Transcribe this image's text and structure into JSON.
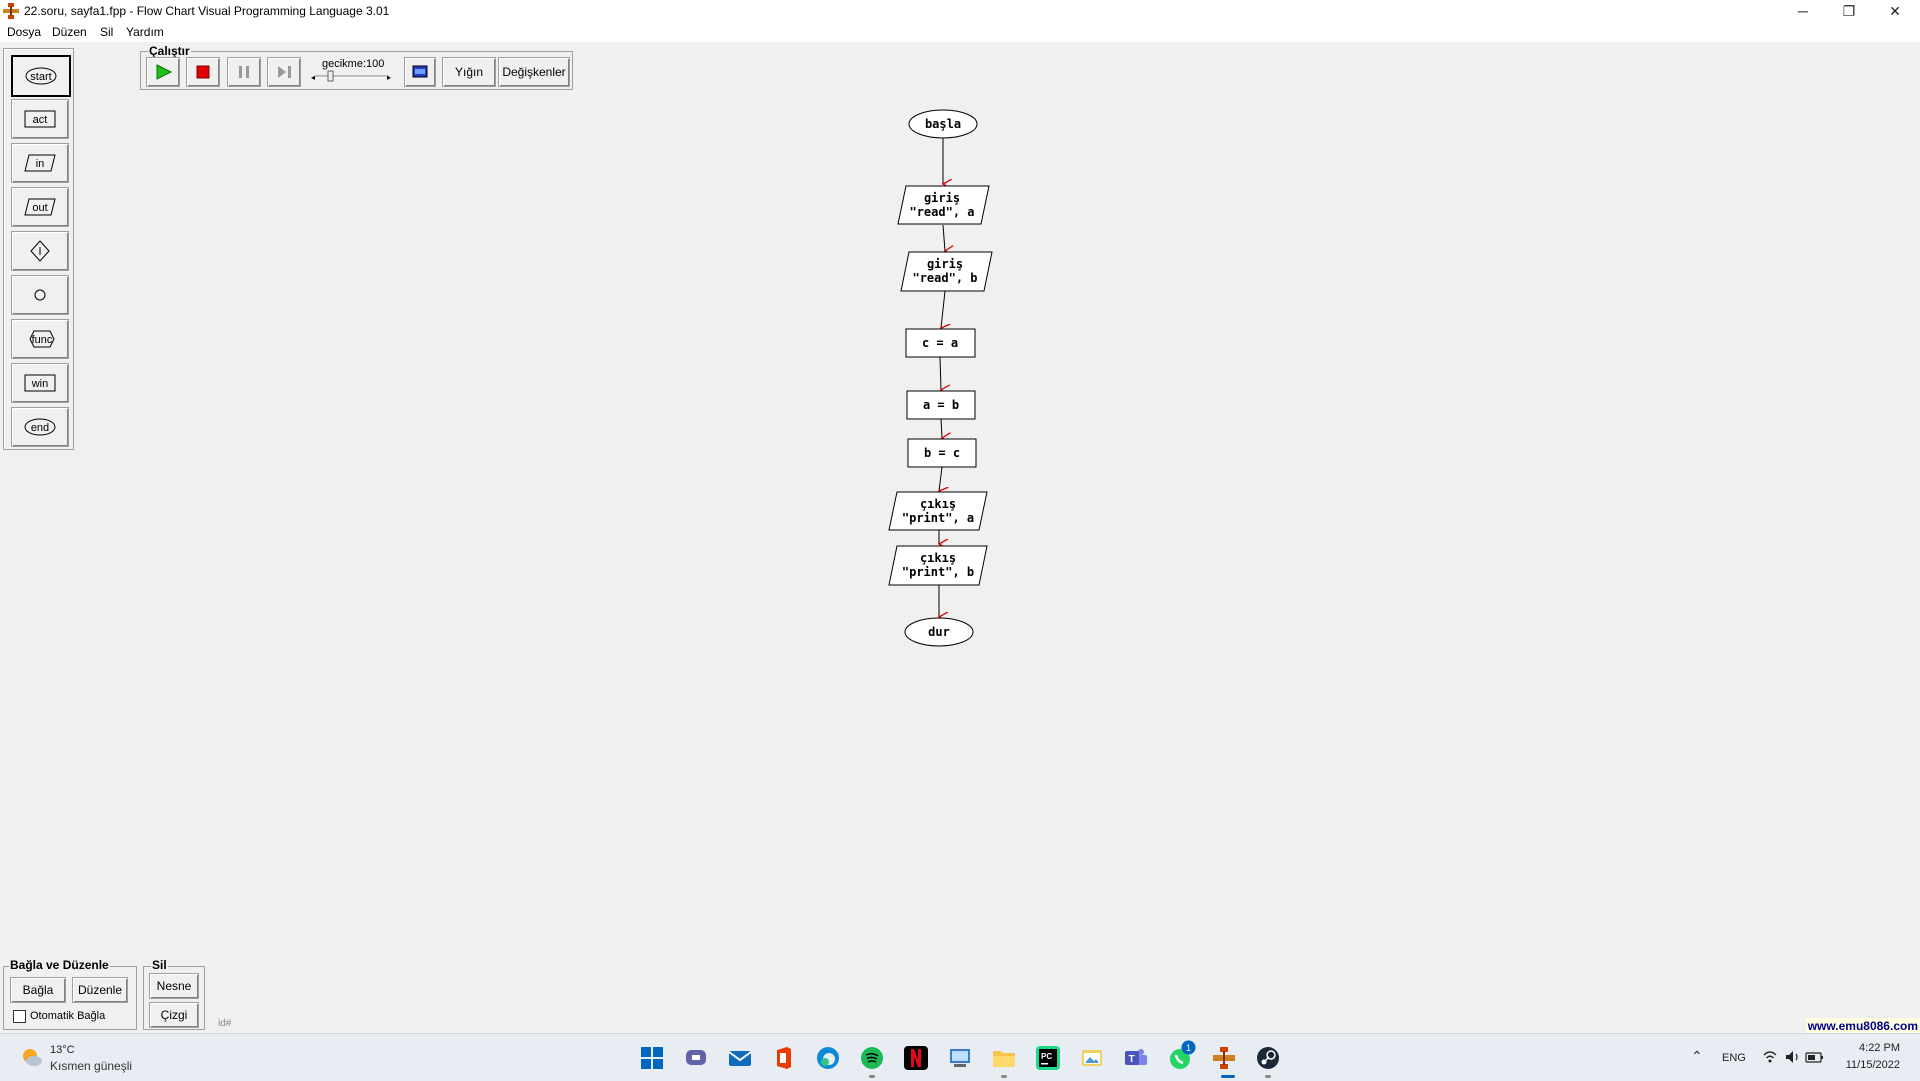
{
  "window": {
    "title": "22.soru, sayfa1.fpp - Flow Chart Visual Programming Language 3.01",
    "minimize_glyph": "─",
    "restore_glyph": "❐",
    "close_glyph": "✕"
  },
  "menu": [
    "Dosya",
    "Düzen",
    "Sil",
    "Yardım"
  ],
  "toolbox": [
    "start",
    "act",
    "in",
    "out",
    "",
    "",
    "func",
    "win",
    "end"
  ],
  "run": {
    "legend": "Çalıştır",
    "delay_label": "gecikme:100",
    "delay_value": 100,
    "stack_label": "Yığın",
    "vars_label": "Değişkenler"
  },
  "flowchart": {
    "start": "başla",
    "input1": [
      "giriş",
      "\"read\", a"
    ],
    "input2": [
      "giriş",
      "\"read\", b"
    ],
    "act1": "c = a",
    "act2": "a = b",
    "act3": "b = c",
    "output1": [
      "çıkış",
      "\"print\", a"
    ],
    "output2": [
      "çıkış",
      "\"print\", b"
    ],
    "end": "dur"
  },
  "connect_panel": {
    "legend": "Bağla ve Düzenle",
    "connect_label": "Bağla",
    "arrange_label": "Düzenle",
    "auto_label": "Otomatik Bağla",
    "auto_checked": false
  },
  "delete_panel": {
    "legend": "Sil",
    "object_label": "Nesne",
    "line_label": "Çizgi"
  },
  "status": {
    "id_label": "id#",
    "link": "www.emu8086.com"
  },
  "taskbar": {
    "weather_temp": "13°C",
    "weather_desc": "Kısmen güneşli",
    "lang": "ENG",
    "time": "4:22 PM",
    "date": "11/15/2022",
    "whatsapp_badge": "1",
    "apps": [
      "windows-start",
      "teams-chat",
      "mail",
      "office",
      "edge",
      "spotify",
      "netflix",
      "control-panel",
      "file-explorer",
      "pycharm",
      "photos",
      "teams",
      "whatsapp",
      "flowchart",
      "steam"
    ],
    "colors": {
      "accent": "#0067c0",
      "spotify": "#1db954",
      "netflix": "#e50914",
      "office": "#eb3c00"
    }
  }
}
